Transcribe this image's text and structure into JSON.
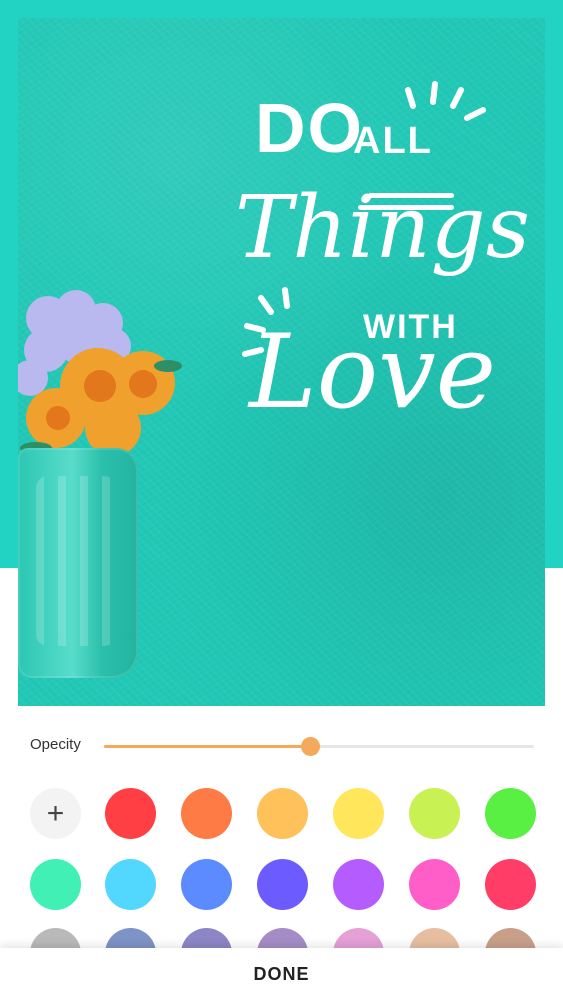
{
  "quote": {
    "line1": "DO",
    "line2": "ALL",
    "line3": "Things",
    "line4": "WITH",
    "line5": "Love"
  },
  "opacity": {
    "label": "Opecity",
    "value_fraction": 0.48,
    "color": "#f5a95a"
  },
  "palette": {
    "add_icon": "plus-icon",
    "add_symbol": "+",
    "colors": [
      "#ff3f43",
      "#ff7b46",
      "#ffc15a",
      "#ffe65b",
      "#c8f254",
      "#59ef43",
      "#40f0b5",
      "#52d7ff",
      "#5b8bff",
      "#6c5cff",
      "#b55cff",
      "#ff5dc8",
      "#ff3d67",
      "#b9b9b9",
      "#7e93c6",
      "#8c86c6",
      "#a58cc6",
      "#e5a0d6",
      "#e7bfa0",
      "#c8a08a"
    ]
  },
  "actions": {
    "done_label": "DONE"
  },
  "colors": {
    "background_band": "#22d2c2",
    "canvas": "#21c8b6"
  }
}
